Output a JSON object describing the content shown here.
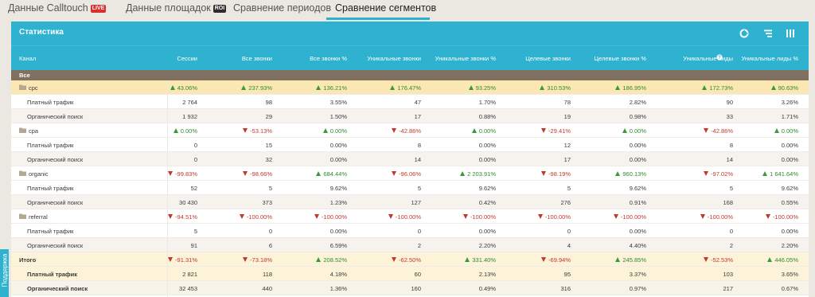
{
  "tabs": [
    {
      "label": "Данные Calltouch",
      "badge": "LIVE",
      "active": false
    },
    {
      "label": "Данные площадок",
      "badge": "ROI",
      "active": false
    },
    {
      "label": "Сравнение периодов",
      "badge": "",
      "active": false
    },
    {
      "label": "Сравнение сегментов",
      "badge": "",
      "active": true
    }
  ],
  "panel": {
    "title": "Статистика",
    "icons": [
      "pie-chart-icon",
      "filter-lines-icon",
      "columns-icon"
    ]
  },
  "columns": [
    "Канал",
    "Сессии",
    "Все звонки",
    "Все звонки %",
    "Уникальные звонки",
    "Уникальные звонки %",
    "Целевые звонки",
    "Целевые звонки %",
    "Уникальные лиды",
    "Уникальные лиды %"
  ],
  "all_row_label": "Все",
  "groups": [
    {
      "name": "cpc",
      "changes": [
        {
          "dir": "up",
          "v": "43.06%"
        },
        {
          "dir": "up",
          "v": "237.93%"
        },
        {
          "dir": "up",
          "v": "136.21%"
        },
        {
          "dir": "up",
          "v": "176.47%"
        },
        {
          "dir": "up",
          "v": "93.25%"
        },
        {
          "dir": "up",
          "v": "310.53%"
        },
        {
          "dir": "up",
          "v": "186.95%"
        },
        {
          "dir": "up",
          "v": "172.73%"
        },
        {
          "dir": "up",
          "v": "90.63%"
        }
      ],
      "rows": [
        {
          "label": "Платный трафик",
          "values": [
            "2 764",
            "98",
            "3.55%",
            "47",
            "1.70%",
            "78",
            "2.82%",
            "90",
            "3.26%"
          ]
        },
        {
          "label": "Органический поиск",
          "values": [
            "1 932",
            "29",
            "1.50%",
            "17",
            "0.88%",
            "19",
            "0.98%",
            "33",
            "1.71%"
          ]
        }
      ]
    },
    {
      "name": "cpa",
      "changes": [
        {
          "dir": "up",
          "v": "0.00%"
        },
        {
          "dir": "down",
          "v": "-53.13%"
        },
        {
          "dir": "up",
          "v": "0.00%"
        },
        {
          "dir": "down",
          "v": "-42.86%"
        },
        {
          "dir": "up",
          "v": "0.00%"
        },
        {
          "dir": "down",
          "v": "-29.41%"
        },
        {
          "dir": "up",
          "v": "0.00%"
        },
        {
          "dir": "down",
          "v": "-42.86%"
        },
        {
          "dir": "up",
          "v": "0.00%"
        }
      ],
      "rows": [
        {
          "label": "Платный трафик",
          "values": [
            "0",
            "15",
            "0.00%",
            "8",
            "0.00%",
            "12",
            "0.00%",
            "8",
            "0.00%"
          ]
        },
        {
          "label": "Органический поиск",
          "values": [
            "0",
            "32",
            "0.00%",
            "14",
            "0.00%",
            "17",
            "0.00%",
            "14",
            "0.00%"
          ]
        }
      ]
    },
    {
      "name": "organic",
      "changes": [
        {
          "dir": "down",
          "v": "-99.83%"
        },
        {
          "dir": "down",
          "v": "-98.66%"
        },
        {
          "dir": "up",
          "v": "684.44%"
        },
        {
          "dir": "down",
          "v": "-96.06%"
        },
        {
          "dir": "up",
          "v": "2 203.91%"
        },
        {
          "dir": "down",
          "v": "-98.19%"
        },
        {
          "dir": "up",
          "v": "960.13%"
        },
        {
          "dir": "down",
          "v": "-97.02%"
        },
        {
          "dir": "up",
          "v": "1 641.64%"
        }
      ],
      "rows": [
        {
          "label": "Платный трафик",
          "values": [
            "52",
            "5",
            "9.62%",
            "5",
            "9.62%",
            "5",
            "9.62%",
            "5",
            "9.62%"
          ]
        },
        {
          "label": "Органический поиск",
          "values": [
            "30 430",
            "373",
            "1.23%",
            "127",
            "0.42%",
            "276",
            "0.91%",
            "168",
            "0.55%"
          ]
        }
      ]
    },
    {
      "name": "referral",
      "changes": [
        {
          "dir": "down",
          "v": "-94.51%"
        },
        {
          "dir": "down",
          "v": "-100.00%"
        },
        {
          "dir": "down",
          "v": "-100.00%"
        },
        {
          "dir": "down",
          "v": "-100.00%"
        },
        {
          "dir": "down",
          "v": "-100.00%"
        },
        {
          "dir": "down",
          "v": "-100.00%"
        },
        {
          "dir": "down",
          "v": "-100.00%"
        },
        {
          "dir": "down",
          "v": "-100.00%"
        },
        {
          "dir": "down",
          "v": "-100.00%"
        }
      ],
      "rows": [
        {
          "label": "Платный трафик",
          "values": [
            "5",
            "0",
            "0.00%",
            "0",
            "0.00%",
            "0",
            "0.00%",
            "0",
            "0.00%"
          ]
        },
        {
          "label": "Органический поиск",
          "values": [
            "91",
            "6",
            "6.59%",
            "2",
            "2.20%",
            "4",
            "4.40%",
            "2",
            "2.20%"
          ]
        }
      ]
    }
  ],
  "total": {
    "label": "Итого",
    "changes": [
      {
        "dir": "down",
        "v": "-91.31%"
      },
      {
        "dir": "down",
        "v": "-73.18%"
      },
      {
        "dir": "up",
        "v": "208.52%"
      },
      {
        "dir": "down",
        "v": "-62.50%"
      },
      {
        "dir": "up",
        "v": "331.40%"
      },
      {
        "dir": "down",
        "v": "-69.94%"
      },
      {
        "dir": "up",
        "v": "245.85%"
      },
      {
        "dir": "down",
        "v": "-52.53%"
      },
      {
        "dir": "up",
        "v": "446.05%"
      }
    ],
    "rows": [
      {
        "label": "Платный трафик",
        "values": [
          "2 821",
          "118",
          "4.18%",
          "60",
          "2.13%",
          "95",
          "3.37%",
          "103",
          "3.65%"
        ]
      },
      {
        "label": "Органический поиск",
        "values": [
          "32 453",
          "440",
          "1.36%",
          "160",
          "0.49%",
          "316",
          "0.97%",
          "217",
          "0.67%"
        ]
      }
    ]
  },
  "support_label": "Поддержка",
  "colors": {
    "accent": "#2eb2cf",
    "up": "#3a9a3a",
    "down": "#c0392b",
    "cpc_highlight": "#fbe7b3",
    "all_row": "#7f705f"
  }
}
